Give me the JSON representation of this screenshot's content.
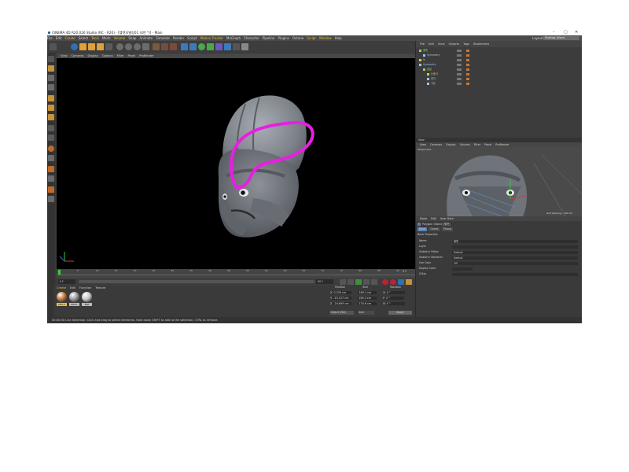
{
  "window": {
    "title": "CINEMA 4D R20.026 Studio (RC - R20) - [헬멧모델링01 (4번 *)] - Main",
    "controls": [
      "–",
      "▢",
      "✕"
    ]
  },
  "menubar": {
    "items": [
      {
        "label": "File",
        "hl": false
      },
      {
        "label": "Edit",
        "hl": false
      },
      {
        "label": "Create",
        "hl": true
      },
      {
        "label": "Select",
        "hl": false
      },
      {
        "label": "Tools",
        "hl": true
      },
      {
        "label": "Mesh",
        "hl": false
      },
      {
        "label": "Volume",
        "hl": true
      },
      {
        "label": "Snap",
        "hl": false
      },
      {
        "label": "Animate",
        "hl": false
      },
      {
        "label": "Simulate",
        "hl": false
      },
      {
        "label": "Render",
        "hl": false
      },
      {
        "label": "Sculpt",
        "hl": false
      },
      {
        "label": "Motion Tracker",
        "hl": true
      },
      {
        "label": "MoGraph",
        "hl": false
      },
      {
        "label": "Character",
        "hl": false
      },
      {
        "label": "Pipeline",
        "hl": false
      },
      {
        "label": "Plugins",
        "hl": false
      },
      {
        "label": "Octane",
        "hl": false
      },
      {
        "label": "Script",
        "hl": true
      },
      {
        "label": "Window",
        "hl": true
      },
      {
        "label": "Help",
        "hl": false
      }
    ],
    "layout_label": "Layout:",
    "layout_value": "Startup (User)"
  },
  "viewport": {
    "menu": [
      "View",
      "Cameras",
      "Display",
      "Options",
      "Filter",
      "Panel",
      "ProRender"
    ],
    "colors": {
      "background": "#000000",
      "helmet": "#8a8f96",
      "stroke": "#e81fe3"
    }
  },
  "timeline": {
    "ticks": [
      "0",
      "5",
      "10",
      "15",
      "20",
      "25",
      "30",
      "35",
      "40",
      "45",
      "50",
      "55",
      "60",
      "65",
      "70",
      "75",
      "80",
      "85",
      "90"
    ],
    "frame_label": "0 F",
    "start": "0 F",
    "end": "90 F"
  },
  "materials": {
    "tabs": [
      {
        "label": "Create",
        "hl": true
      },
      {
        "label": "Edit",
        "hl": false
      },
      {
        "label": "Function",
        "hl": false
      },
      {
        "label": "Texture",
        "hl": false
      }
    ],
    "items": [
      {
        "name": "Mat.2",
        "color": "#c07a3c"
      },
      {
        "name": "Mat.1",
        "color": "#9a9a9a"
      },
      {
        "name": "Mat",
        "color": "#c8c8c8"
      }
    ]
  },
  "coordinates": {
    "headers": [
      "Position",
      "Size",
      "Rotation"
    ],
    "rows": [
      {
        "axis": "X",
        "pos": "0.235 cm",
        "size": "169.1 cm",
        "rot_axis": "H",
        "rot": "0 °"
      },
      {
        "axis": "Y",
        "pos": "-10.127 cm",
        "size": "158.3 cm",
        "rot_axis": "P",
        "rot": "0 °"
      },
      {
        "axis": "Z",
        "pos": "-24.659 cm",
        "size": "174.6 cm",
        "rot_axis": "B",
        "rot": "0 °"
      }
    ],
    "mode": "Object (Rel)",
    "size_mode": "Size",
    "apply": "Apply"
  },
  "status": {
    "text": "00:00:00    Live Selection: Click and drag to select elements. Hold down SHIFT to add to the selection, CTRL to remove."
  },
  "object_manager": {
    "menu": [
      "File",
      "Edit",
      "View",
      "Objects",
      "Tags",
      "Bookmarks"
    ],
    "rows": [
      {
        "name": "헬멧",
        "indent": 0,
        "color": "#8fd46c"
      },
      {
        "name": "Symmetry",
        "indent": 1,
        "color": "#9ec3e8"
      },
      {
        "name": "눈",
        "indent": 0,
        "color": "#e8c13c"
      },
      {
        "name": "Symmetry",
        "indent": 0,
        "color": "#9ec3e8"
      },
      {
        "name": "얼굴",
        "indent": 1,
        "color": "#8fd46c"
      },
      {
        "name": "눈동자",
        "indent": 2,
        "color": "#e8c13c"
      },
      {
        "name": "흰자",
        "indent": 2,
        "color": "#9ec3e8"
      },
      {
        "name": "기본",
        "indent": 2,
        "color": "#9ec3e8"
      }
    ]
  },
  "view_panel": {
    "title": "View",
    "menu": [
      "View",
      "Cameras",
      "Display",
      "Options",
      "Filter",
      "Panel",
      "ProRender"
    ],
    "perspective": "Perspective",
    "grid_spacing": "Grid Spacing : 100 cm"
  },
  "attributes": {
    "menu": [
      "Mode",
      "Edit",
      "User Data"
    ],
    "object_title": "Polygon Object [헬멧]",
    "tabs": [
      "Basic",
      "Coord.",
      "Phong"
    ],
    "section": "Basic Properties",
    "fields": [
      {
        "label": "Name",
        "value": "헬멧"
      },
      {
        "label": "Layer",
        "value": ""
      },
      {
        "label": "Visible in Editor",
        "value": "Default"
      },
      {
        "label": "Visible in Renderer",
        "value": "Default"
      },
      {
        "label": "Use Color",
        "value": "Off"
      },
      {
        "label": "Display Color",
        "value": ""
      },
      {
        "label": "X-Ray",
        "value": ""
      }
    ]
  }
}
